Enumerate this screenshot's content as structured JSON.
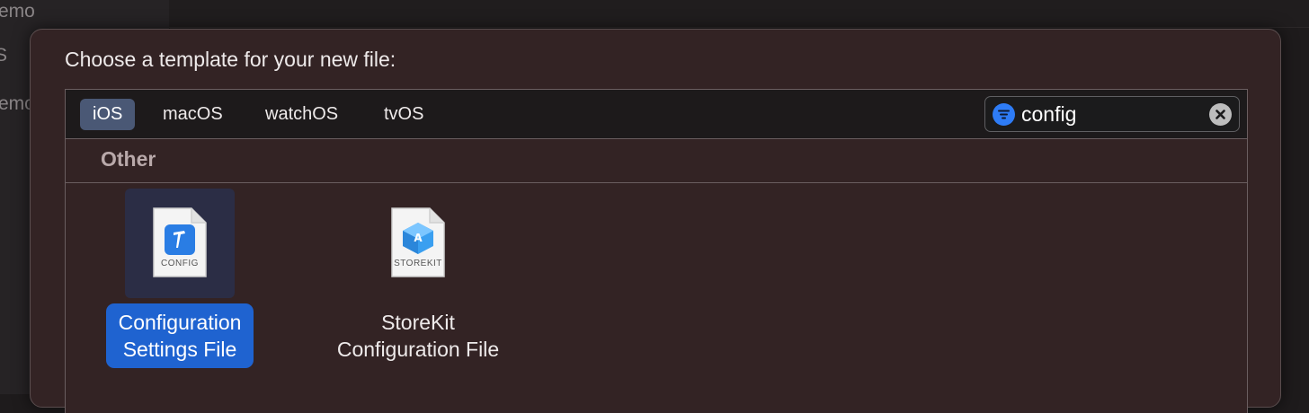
{
  "background": {
    "sidebar_fragments": [
      "emo",
      "S",
      "emo"
    ]
  },
  "sheet": {
    "title": "Choose a template for your new file:"
  },
  "platforms": [
    {
      "label": "iOS",
      "active": true
    },
    {
      "label": "macOS",
      "active": false
    },
    {
      "label": "watchOS",
      "active": false
    },
    {
      "label": "tvOS",
      "active": false
    }
  ],
  "search": {
    "value": "config",
    "filter_icon": "filter-icon",
    "clear_icon": "clear-icon"
  },
  "section": {
    "title": "Other"
  },
  "templates": [
    {
      "icon_tag": "CONFIG",
      "label_line1": "Configuration",
      "label_line2": "Settings File",
      "selected": true
    },
    {
      "icon_tag": "STOREKIT",
      "label_line1": "StoreKit",
      "label_line2": "Configuration File",
      "selected": false
    }
  ],
  "colors": {
    "accent": "#1f63d0",
    "sheet_bg": "#332324",
    "filter_blue": "#2e7cf6",
    "tab_active": "#4a5875"
  }
}
